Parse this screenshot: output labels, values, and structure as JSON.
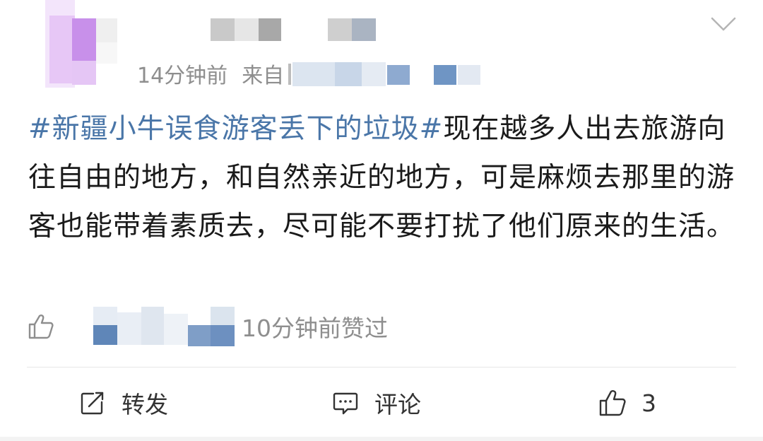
{
  "post": {
    "time_ago": "14分钟前",
    "source_prefix": "来自",
    "topic": "#新疆小牛误食游客丢下的垃圾#",
    "body": "现在越多人出去旅游向往自由的地方，和自然亲近的地方，可是麻烦去那里的游客也能带着素质去，尽可能不要打扰了他们原来的生活。",
    "liked_info": "10分钟前赞过"
  },
  "actions": {
    "repost_label": "转发",
    "comment_label": "评论",
    "like_count": "3"
  },
  "colors": {
    "topic_link": "#4a76a8",
    "meta_gray": "#8e8e8e",
    "blur_blue": "#6f95c4",
    "avatar_purple": "#c48ee9"
  },
  "icons": {
    "more": "chevron-down-icon",
    "like_small": "thumbs-up-icon",
    "repost": "repost-icon",
    "comment": "comment-icon",
    "like": "thumbs-up-icon"
  }
}
